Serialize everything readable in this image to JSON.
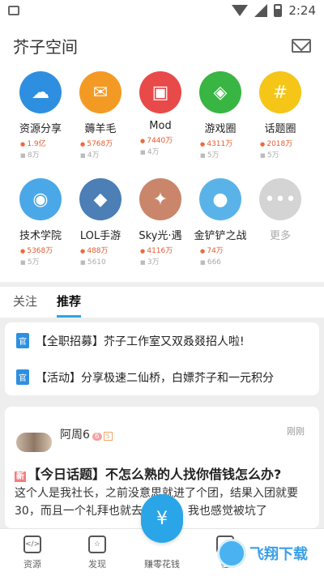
{
  "status": {
    "time": "2:24"
  },
  "header": {
    "title": "芥子空间"
  },
  "grid": [
    {
      "name": "资源分享",
      "hot": "1.9亿",
      "views": "8万",
      "color": "#2e8fe0",
      "icon": "cloud-upload-icon",
      "glyph": "☁"
    },
    {
      "name": "薅羊毛",
      "hot": "5768万",
      "views": "4万",
      "color": "#f39a25",
      "icon": "envelope-icon",
      "glyph": "✉"
    },
    {
      "name": "Mod",
      "hot": "7440万",
      "views": "4万",
      "color": "#e84a4a",
      "icon": "gamepad-icon",
      "glyph": "▣"
    },
    {
      "name": "游戏圈",
      "hot": "4311万",
      "views": "5万",
      "color": "#39b543",
      "icon": "camera-shutter-icon",
      "glyph": "◈"
    },
    {
      "name": "话题圈",
      "hot": "2018万",
      "views": "5万",
      "color": "#f5c518",
      "icon": "user-hashtag-icon",
      "glyph": "#"
    },
    {
      "name": "技术学院",
      "hot": "5368万",
      "views": "5万",
      "color": "#4aa8e8",
      "icon": "hacker-icon",
      "glyph": "◉"
    },
    {
      "name": "LOL手游",
      "hot": "488万",
      "views": "5610",
      "color": "#4b7fb5",
      "icon": "lol-avatar-icon",
      "glyph": "◆"
    },
    {
      "name": "Sky光·遇",
      "hot": "4116万",
      "views": "3万",
      "color": "#c9866b",
      "icon": "sky-avatar-icon",
      "glyph": "✦"
    },
    {
      "name": "金铲铲之战",
      "hot": "74万",
      "views": "666",
      "color": "#5ab3e8",
      "icon": "penguin-avatar-icon",
      "glyph": "●"
    },
    {
      "name": "更多",
      "hot": "",
      "views": "",
      "color": "#d4d4d4",
      "icon": "more-dots-icon",
      "glyph": "•••"
    }
  ],
  "tabs": [
    "关注",
    "推荐"
  ],
  "notices": [
    {
      "tag": "官",
      "text": "【全职招募】芥子工作室又双叒叕招人啦!"
    },
    {
      "tag": "官",
      "text": "【活动】分享极速二仙桥，白嫖芥子和一元积分"
    }
  ],
  "post": {
    "author": "阿周6",
    "level": "6",
    "level2": "5",
    "time": "刚刚",
    "new_tag": "新",
    "title": "【今日话题】不怎么熟的人找你借钱怎么办?",
    "body": "这个人是我社长，之前没意思就进了个团，结果入团就要30，而且一个礼拜也就去一两次，我也感觉被坑了"
  },
  "nav": {
    "resources": "资源",
    "discover": "发现",
    "earn": "赚零花钱",
    "community": "社",
    "fab_glyph": "¥"
  },
  "watermark": {
    "text": "飞翔下载"
  }
}
